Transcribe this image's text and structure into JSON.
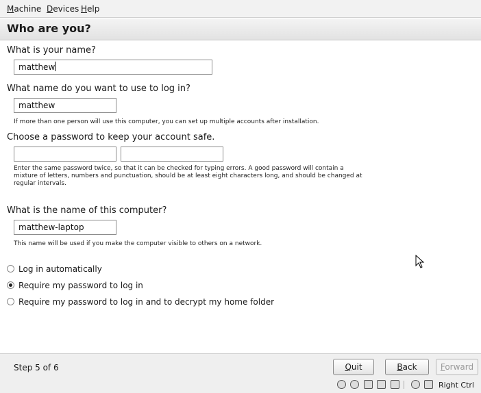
{
  "menu": {
    "items": [
      {
        "key": "M",
        "rest": "achine"
      },
      {
        "key": "D",
        "rest": "evices"
      },
      {
        "key": "H",
        "rest": "elp"
      }
    ]
  },
  "title": "Who are you?",
  "name_section": {
    "label": "What is your name?",
    "value": "matthew"
  },
  "login_section": {
    "label": "What name do you want to use to log in?",
    "value": "matthew",
    "help": "If more than one person will use this computer, you can set up multiple accounts after installation."
  },
  "password_section": {
    "label": "Choose a password to keep your account safe.",
    "password_value": "",
    "confirm_value": "",
    "help_lines": [
      "Enter the same password twice, so that it can be checked for typing errors. A good password will contain a",
      "mixture of letters, numbers and punctuation, should be at least eight characters long, and should be changed at",
      "regular intervals."
    ]
  },
  "computer_section": {
    "label": "What is the name of this computer?",
    "value": "matthew-laptop",
    "help": "This name will be used if you make the computer visible to others on a network."
  },
  "login_options": [
    {
      "label": "Log in automatically",
      "checked": false
    },
    {
      "label": "Require my password to log in",
      "checked": true
    },
    {
      "label": "Require my password to log in and to decrypt my home folder",
      "checked": false
    }
  ],
  "footer": {
    "step": "Step 5 of 6",
    "quit": {
      "key": "Q",
      "rest": "uit"
    },
    "back": {
      "key": "B",
      "rest": "ack"
    },
    "forward": {
      "key": "F",
      "rest": "orward"
    }
  },
  "statusbar": {
    "host_key": "Right Ctrl",
    "icons": [
      "hard-disk-icon",
      "cd-drive-icon",
      "floppy-icon",
      "network-icon",
      "usb-icon",
      "shared-folders-icon",
      "mouse-integration-icon"
    ]
  }
}
